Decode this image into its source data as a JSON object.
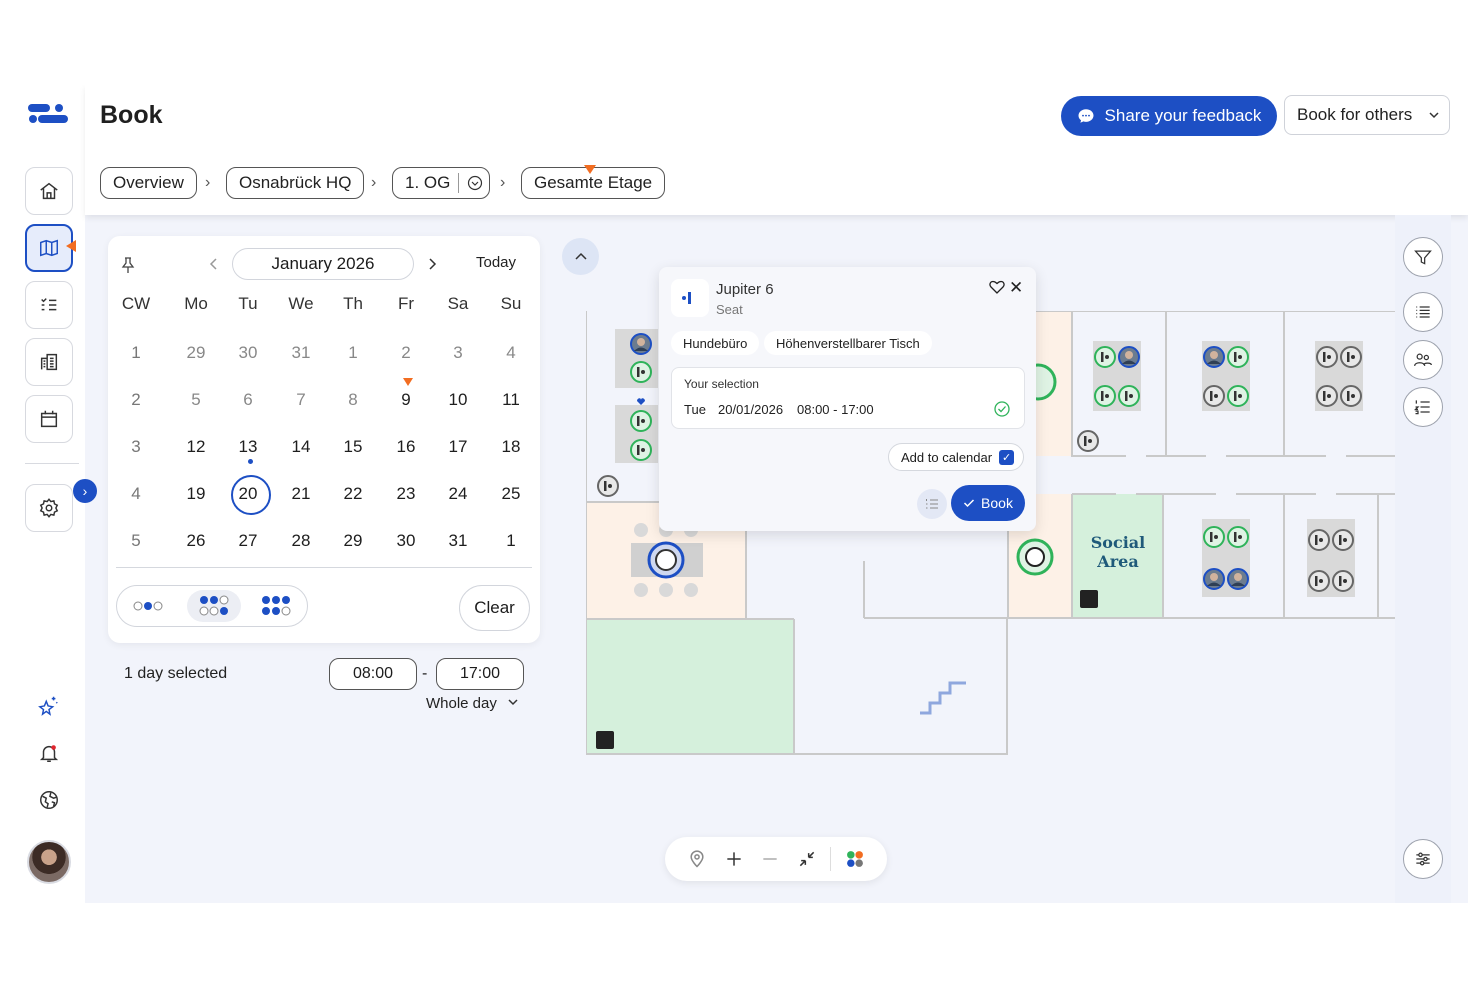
{
  "header": {
    "title": "Book",
    "feedback_label": "Share your feedback",
    "book_for_others_label": "Book for others"
  },
  "breadcrumb": {
    "overview": "Overview",
    "location": "Osnabrück HQ",
    "floor": "1. OG",
    "area": "Gesamte Etage"
  },
  "calendar": {
    "month_label": "January 2026",
    "today_label": "Today",
    "headers": [
      "CW",
      "Mo",
      "Tu",
      "We",
      "Th",
      "Fr",
      "Sa",
      "Su"
    ],
    "weeks": [
      [
        "1",
        "29",
        "30",
        "31",
        "1",
        "2",
        "3",
        "4"
      ],
      [
        "2",
        "5",
        "6",
        "7",
        "8",
        "9",
        "10",
        "11"
      ],
      [
        "3",
        "12",
        "13",
        "14",
        "15",
        "16",
        "17",
        "18"
      ],
      [
        "4",
        "19",
        "20",
        "21",
        "22",
        "23",
        "24",
        "25"
      ],
      [
        "5",
        "26",
        "27",
        "28",
        "29",
        "30",
        "31",
        "1"
      ]
    ],
    "selected_day": "20",
    "clear_label": "Clear"
  },
  "selection": {
    "days_selected": "1 day selected",
    "start_time": "08:00",
    "separator": "-",
    "end_time": "17:00",
    "whole_day_label": "Whole day"
  },
  "popup": {
    "title": "Jupiter 6",
    "subtitle": "Seat",
    "tags": [
      "Hundebüro",
      "Höhenverstellbarer Tisch"
    ],
    "selection_label": "Your selection",
    "day": "Tue",
    "date": "20/01/2026",
    "time": "08:00 - 17:00",
    "add_to_calendar_label": "Add to calendar",
    "book_label": "Book"
  },
  "map": {
    "social_area_label": "Social Area"
  },
  "colors": {
    "primary": "#1d4fc4",
    "accent_orange": "#f26d21",
    "available_green": "#2fb35a",
    "room_green": "#d5f0dc",
    "room_peach": "#fdf1e7"
  },
  "icons": {
    "sidebar": [
      "home-icon",
      "map-icon",
      "checklist-icon",
      "building-icon",
      "calendar-icon",
      "settings-icon",
      "sparkle-icon",
      "bell-icon",
      "globe-icon"
    ],
    "right_rail": [
      "filter-icon",
      "list-icon",
      "people-icon",
      "numbered-list-icon",
      "sliders-icon"
    ],
    "zoom_bar": [
      "location-pin-icon",
      "plus-icon",
      "minus-icon",
      "collapse-icon",
      "color-legend-icon"
    ]
  }
}
